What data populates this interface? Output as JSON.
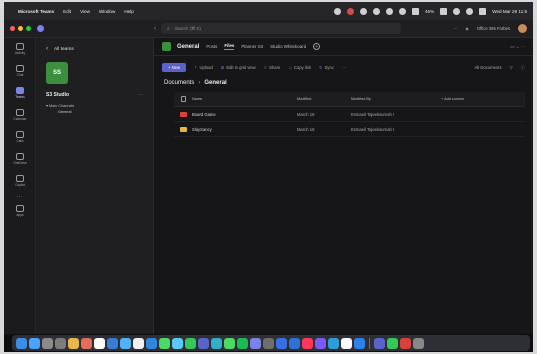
{
  "menubar": {
    "app": "Microsoft Teams",
    "menus": [
      "Edit",
      "View",
      "Window",
      "Help"
    ],
    "battery": "46%",
    "datetime": "Wed Mar 26 11:5"
  },
  "titlebar": {
    "search_placeholder": "Search (⌘ E)",
    "org": "Office 365 Forbes"
  },
  "rail": {
    "items": [
      {
        "label": "Activity",
        "icon": "bell-icon"
      },
      {
        "label": "Chat",
        "icon": "chat-icon"
      },
      {
        "label": "Teams",
        "icon": "teams-icon",
        "active": true
      },
      {
        "label": "Calendar",
        "icon": "calendar-icon"
      },
      {
        "label": "Calls",
        "icon": "phone-icon"
      },
      {
        "label": "OneDrive",
        "icon": "cloud-icon"
      },
      {
        "label": "Copilot",
        "icon": "copilot-icon"
      },
      {
        "label": "",
        "icon": "more-icon"
      },
      {
        "label": "Apps",
        "icon": "apps-icon"
      }
    ]
  },
  "teampanel": {
    "back_label": "All teams",
    "avatar_initials": "SS",
    "team_name": "S3 Studio",
    "more": "···",
    "channels_header": "Main Channels",
    "channels": [
      "General"
    ]
  },
  "channel": {
    "name": "General",
    "tabs": [
      "Posts",
      "Files",
      "Planner S3",
      "Studio Whiteboard"
    ],
    "active_tab": "Files"
  },
  "toolbar": {
    "new_label": "+ New",
    "items": [
      "Upload",
      "Edit in grid view",
      "Share",
      "Copy link",
      "Sync",
      "···"
    ],
    "right": [
      "All Documents",
      "▽"
    ]
  },
  "breadcrumb": [
    "Documents",
    "General"
  ],
  "table": {
    "headers": {
      "name": "Name",
      "modified": "Modified",
      "modified_by": "Modified By",
      "add": "+ Add column"
    },
    "rows": [
      {
        "name": "Board Game",
        "modified": "March 18",
        "modified_by": "Esmaeil Tajeeksurnah I",
        "color": "#d9413a"
      },
      {
        "name": "SlaySancy",
        "modified": "March 18",
        "modified_by": "Esmaeil Tajeeksurnah I",
        "color": "#e7b73c"
      }
    ]
  },
  "dock": {
    "colors": [
      "#3a8ee6",
      "#4aa3ff",
      "#8b8b8b",
      "#7c7c7c",
      "#e8b64c",
      "#e46c5c",
      "#ffffff",
      "#3a7bd5",
      "#4fb3f6",
      "#f0f0f0",
      "#2e86de",
      "#4cd964",
      "#5ac8fa",
      "#34c759",
      "#5b62c9",
      "#30b0c7",
      "#4cd964",
      "#1db954",
      "#7b83eb",
      "#6e6e6e",
      "#3a6ee6",
      "#2f6fd6",
      "#ff375f",
      "#7a5af8",
      "#2d9cdb",
      "#ffffff",
      "#2f80ed",
      "#5b62c9",
      "#34c759",
      "#d9413a",
      "#888888"
    ]
  }
}
